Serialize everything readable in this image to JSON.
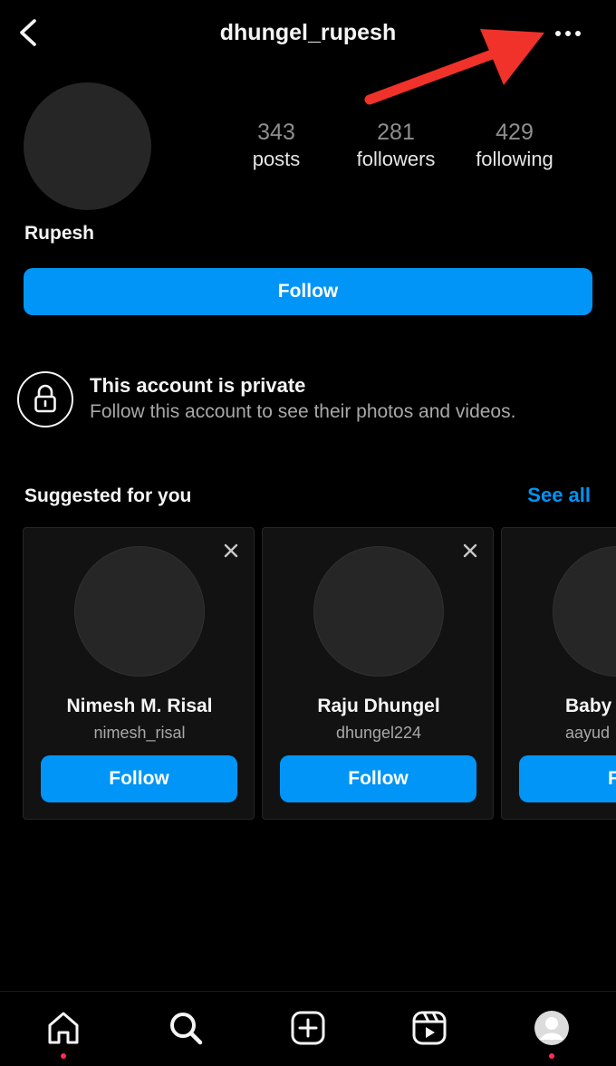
{
  "header": {
    "username": "dhungel_rupesh",
    "back_icon": "chevron-left-icon",
    "more_icon": "more-horizontal-icon",
    "annotation_arrow_color": "#f0322a"
  },
  "profile": {
    "display_name": "Rupesh",
    "stats": [
      {
        "value": "343",
        "label": "posts"
      },
      {
        "value": "281",
        "label": "followers"
      },
      {
        "value": "429",
        "label": "following"
      }
    ],
    "follow_label": "Follow"
  },
  "private": {
    "title": "This account is private",
    "subtitle": "Follow this account to see their photos and videos."
  },
  "suggested": {
    "title": "Suggested for you",
    "see_all": "See all",
    "cards": [
      {
        "name": "Nimesh M. Risal",
        "handle": "nimesh_risal",
        "button": "Follow"
      },
      {
        "name": "Raju Dhungel",
        "handle": "dhungel224",
        "button": "Follow"
      },
      {
        "name": "Baby",
        "handle": "aayud",
        "button": "Fol"
      }
    ]
  },
  "tabbar": {
    "tabs": [
      "home-icon",
      "search-icon",
      "create-icon",
      "reels-icon",
      "profile-icon"
    ]
  },
  "colors": {
    "accent": "#0095f6",
    "background": "#000000",
    "notification_dot": "#ff2d55"
  }
}
